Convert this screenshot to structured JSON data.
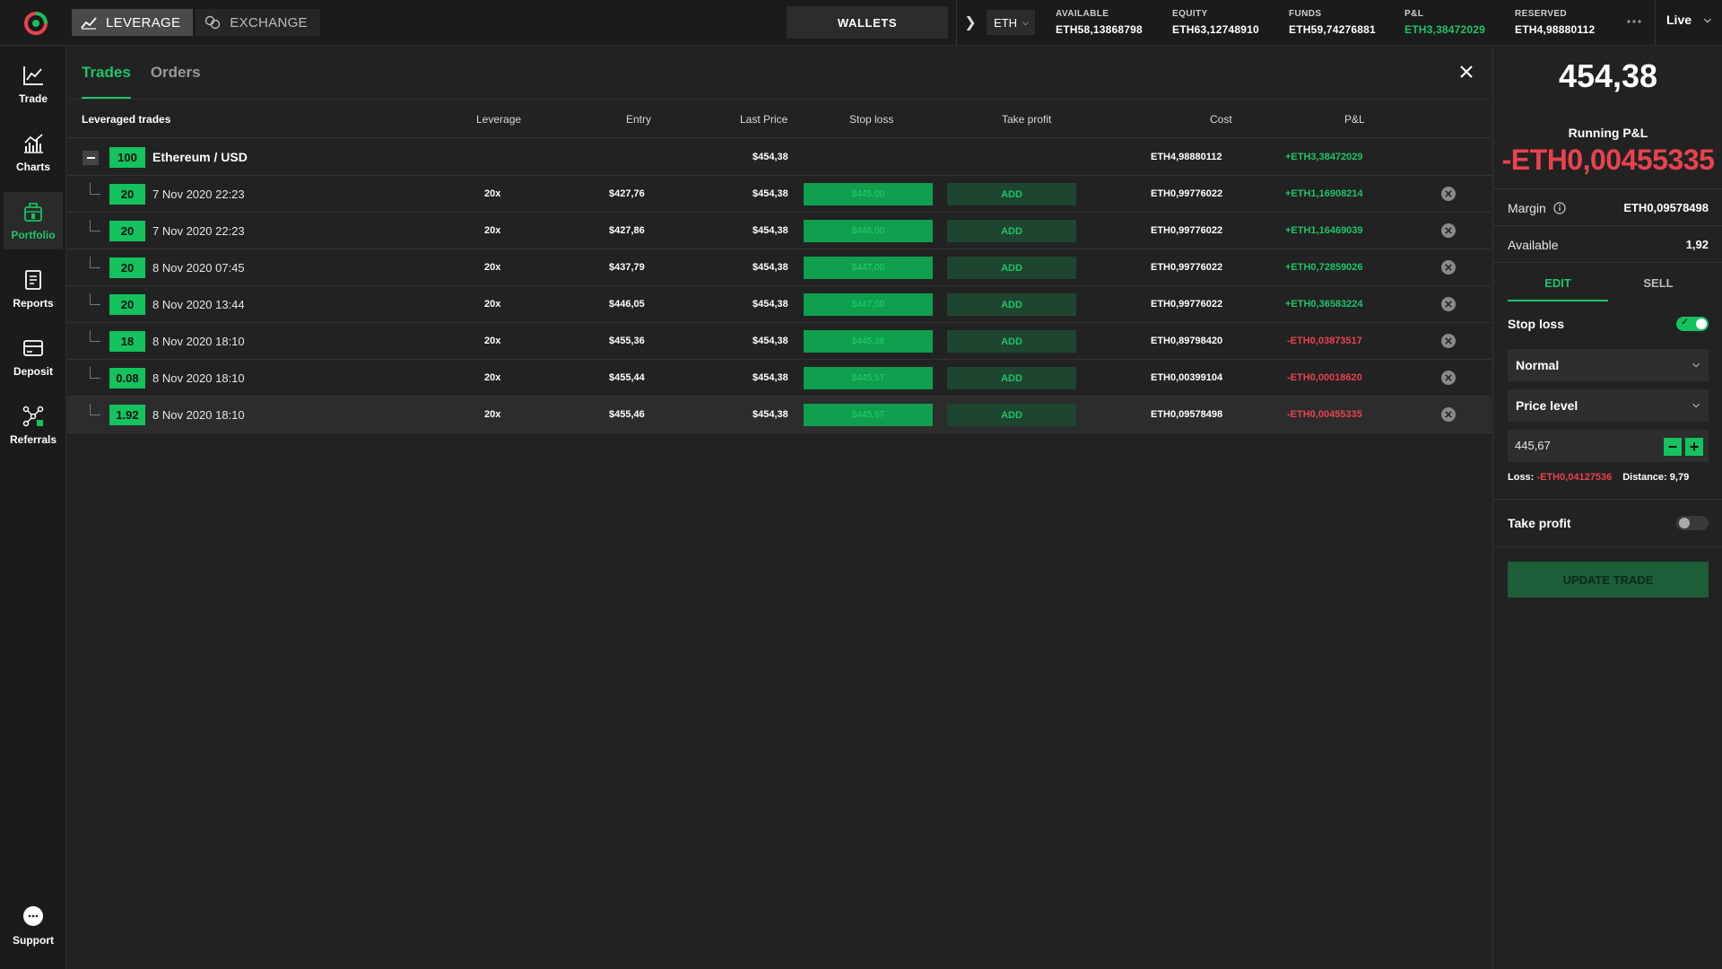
{
  "topbar": {
    "modes": [
      {
        "label": "LEVERAGE",
        "active": true
      },
      {
        "label": "EXCHANGE",
        "active": false
      }
    ],
    "wallets_label": "WALLETS",
    "currency": "ETH",
    "stats": [
      {
        "label": "AVAILABLE",
        "value": "ETH58,13868798",
        "color": "white"
      },
      {
        "label": "EQUITY",
        "value": "ETH63,12748910",
        "color": "white"
      },
      {
        "label": "FUNDS",
        "value": "ETH59,74276881",
        "color": "white"
      },
      {
        "label": "P&L",
        "value": "ETH3,38472029",
        "color": "green"
      },
      {
        "label": "RESERVED",
        "value": "ETH4,98880112",
        "color": "white"
      }
    ],
    "mode_live": "Live"
  },
  "sidebar": {
    "items": [
      {
        "label": "Trade",
        "icon": "trade-chart-icon"
      },
      {
        "label": "Charts",
        "icon": "charts-icon"
      },
      {
        "label": "Portfolio",
        "icon": "portfolio-icon",
        "active": true
      },
      {
        "label": "Reports",
        "icon": "reports-icon"
      },
      {
        "label": "Deposit",
        "icon": "deposit-icon"
      },
      {
        "label": "Referrals",
        "icon": "referrals-icon"
      }
    ],
    "support_label": "Support"
  },
  "main": {
    "tabs": [
      {
        "label": "Trades",
        "active": true
      },
      {
        "label": "Orders",
        "active": false
      }
    ],
    "table": {
      "headers": {
        "name": "Leveraged trades",
        "leverage": "Leverage",
        "entry": "Entry",
        "last_price": "Last Price",
        "stop_loss": "Stop loss",
        "take_profit": "Take profit",
        "cost": "Cost",
        "pl": "P&L"
      },
      "group": {
        "qty": "100",
        "pair": "Ethereum / USD",
        "last_price": "$454,38",
        "cost": "ETH4,98880112",
        "pl": "+ETH3,38472029",
        "pl_sign": "green"
      },
      "rows": [
        {
          "qty": "20",
          "date": "7 Nov 2020 22:23",
          "leverage": "20x",
          "entry": "$427,76",
          "last_price": "$454,38",
          "stop_loss": "$445,00",
          "take_profit": "ADD",
          "cost": "ETH0,99776022",
          "pl": "+ETH1,16908214",
          "pl_sign": "green"
        },
        {
          "qty": "20",
          "date": "7 Nov 2020 22:23",
          "leverage": "20x",
          "entry": "$427,86",
          "last_price": "$454,38",
          "stop_loss": "$446,00",
          "take_profit": "ADD",
          "cost": "ETH0,99776022",
          "pl": "+ETH1,16469039",
          "pl_sign": "green"
        },
        {
          "qty": "20",
          "date": "8 Nov 2020 07:45",
          "leverage": "20x",
          "entry": "$437,79",
          "last_price": "$454,38",
          "stop_loss": "$447,00",
          "take_profit": "ADD",
          "cost": "ETH0,99776022",
          "pl": "+ETH0,72859026",
          "pl_sign": "green"
        },
        {
          "qty": "20",
          "date": "8 Nov 2020 13:44",
          "leverage": "20x",
          "entry": "$446,05",
          "last_price": "$454,38",
          "stop_loss": "$447,00",
          "take_profit": "ADD",
          "cost": "ETH0,99776022",
          "pl": "+ETH0,36583224",
          "pl_sign": "green"
        },
        {
          "qty": "18",
          "date": "8 Nov 2020 18:10",
          "leverage": "20x",
          "entry": "$455,36",
          "last_price": "$454,38",
          "stop_loss": "$445,38",
          "take_profit": "ADD",
          "cost": "ETH0,89798420",
          "pl": "-ETH0,03873517",
          "pl_sign": "red"
        },
        {
          "qty": "0.08",
          "date": "8 Nov 2020 18:10",
          "leverage": "20x",
          "entry": "$455,44",
          "last_price": "$454,38",
          "stop_loss": "$445,57",
          "take_profit": "ADD",
          "cost": "ETH0,00399104",
          "pl": "-ETH0,00018620",
          "pl_sign": "red"
        },
        {
          "qty": "1.92",
          "date": "8 Nov 2020 18:10",
          "leverage": "20x",
          "entry": "$455,46",
          "last_price": "$454,38",
          "stop_loss": "$445,67",
          "take_profit": "ADD",
          "cost": "ETH0,09578498",
          "pl": "-ETH0,00455335",
          "pl_sign": "red",
          "selected": true
        }
      ]
    }
  },
  "panel": {
    "price": "454,38",
    "running_label": "Running P&L",
    "running_value": "-ETH0,00455335",
    "margin_label": "Margin",
    "margin_value": "ETH0,09578498",
    "available_label": "Available",
    "available_value": "1,92",
    "tabs": [
      {
        "label": "EDIT",
        "active": true
      },
      {
        "label": "SELL",
        "active": false
      }
    ],
    "stop_loss_label": "Stop loss",
    "stop_loss_on": true,
    "order_type": "Normal",
    "trigger_type": "Price level",
    "price_value": "445,67",
    "loss_label": "Loss:",
    "loss_value": "-ETH0,04127536",
    "distance_label": "Distance:",
    "distance_value": "9,79",
    "take_profit_label": "Take profit",
    "take_profit_on": false,
    "update_label": "UPDATE TRADE"
  },
  "colors": {
    "accent_green": "#14c25e",
    "loss_red": "#e8424e",
    "background": "#222222"
  }
}
